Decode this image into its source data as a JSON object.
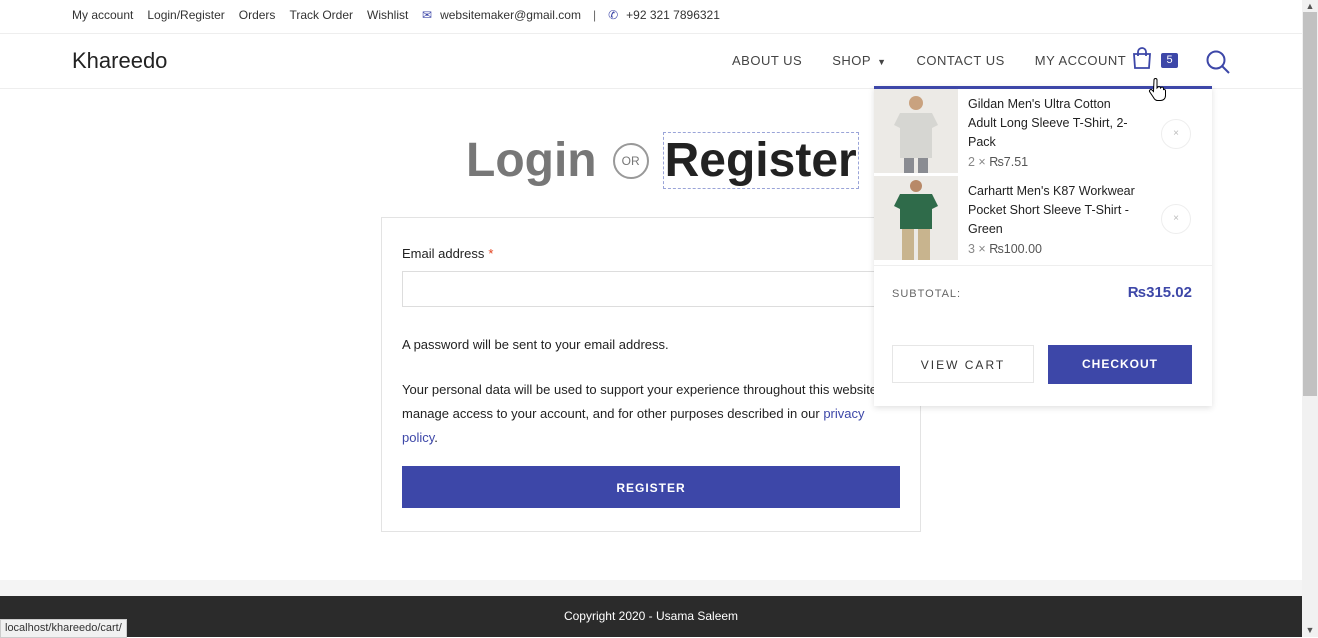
{
  "topbar": {
    "links": [
      "My account",
      "Login/Register",
      "Orders",
      "Track Order",
      "Wishlist"
    ],
    "email": "websitemaker@gmail.com",
    "separator": "|",
    "phone": "+92 321 7896321",
    "email_icon": "envelope-icon",
    "phone_icon": "phone-icon"
  },
  "header": {
    "logo": "Khareedo",
    "nav": [
      "ABOUT US",
      "SHOP",
      "CONTACT US",
      "MY ACCOUNT"
    ],
    "cart_count": "5",
    "cart_icon": "shopping-bag-icon",
    "search_icon": "search-icon"
  },
  "heading": {
    "login": "Login",
    "or": "OR",
    "register": "Register"
  },
  "form": {
    "email_label": "Email address",
    "required_mark": "*",
    "email_value": "",
    "password_note": "A password will be sent to your email address.",
    "privacy_text": "Your personal data will be used to support your experience throughout this website, to manage access to your account, and for other purposes described in our",
    "privacy_link": "privacy policy",
    "privacy_end": ".",
    "register_button": "REGISTER"
  },
  "minicart": {
    "items": [
      {
        "name": "Gildan Men's Ultra Cotton Adult Long Sleeve T-Shirt, 2-Pack",
        "qty": "2 ×",
        "price": "₨7.51"
      },
      {
        "name": "Carhartt Men's K87 Workwear Pocket Short Sleeve T-Shirt - Green",
        "qty": "3 ×",
        "price": "₨100.00"
      }
    ],
    "remove_symbol": "×",
    "subtotal_label": "SUBTOTAL:",
    "subtotal_value": "₨315.02",
    "view_cart": "VIEW CART",
    "checkout": "CHECKOUT"
  },
  "footer": {
    "copyright": "Copyright 2020 - Usama Saleem"
  },
  "status_bar": {
    "url": "localhost/khareedo/cart/"
  },
  "colors": {
    "accent": "#3d47a8",
    "footer_bg": "#2b2b2b"
  }
}
